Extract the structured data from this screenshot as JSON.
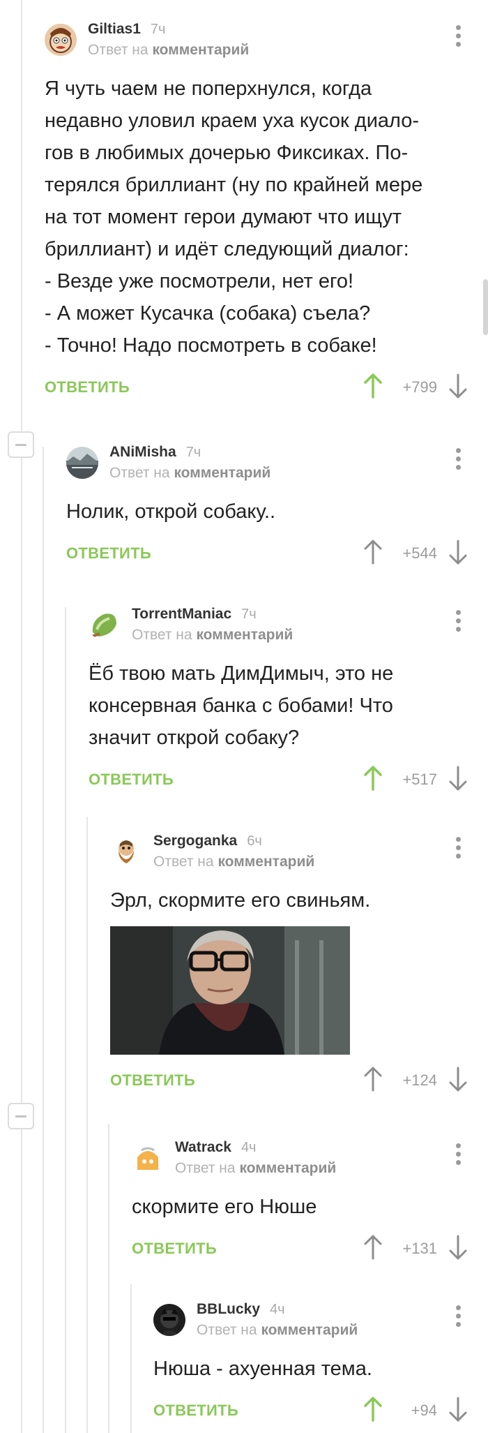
{
  "reply_label": "ОТВЕТИТЬ",
  "reply_prefix": "Ответ на",
  "reply_target": "комментарий",
  "colors": {
    "accent_green": "#8ac858",
    "vote_gray": "#9c9c9c",
    "thread_line": "#e6e6e6"
  },
  "icons": {
    "upvote": "arrow-up-icon",
    "downvote": "arrow-down-icon",
    "more": "more-vertical-icon",
    "collapse": "collapse-thread-icon"
  },
  "comments": [
    {
      "author": "Giltias1",
      "time": "7ч",
      "lines": [
        "Я чуть чаем не поперхнулся, когда",
        "недавно уловил краем уха кусок диало-",
        "гов в любимых дочерью Фиксиках. По-",
        "терялся бриллиант (ну по крайней мере",
        "на тот момент герои думают что ищут",
        "бриллиант) и идёт следующий диалог:",
        "- Везде уже посмотрели, нет его!",
        "- А может Кусачка (собака) съела?",
        "- Точно! Надо посмотреть в собаке!"
      ],
      "rating": "+799",
      "upvoted": true
    },
    {
      "author": "ANiMisha",
      "time": "7ч",
      "lines": [
        "Нолик, открой собаку.."
      ],
      "rating": "+544",
      "upvoted": false
    },
    {
      "author": "TorrentManiac",
      "time": "7ч",
      "lines": [
        "Ёб твою мать ДимДимыч, это не",
        "консервная банка с бобами! Что",
        "значит открой собаку?"
      ],
      "rating": "+517",
      "upvoted": true
    },
    {
      "author": "Sergoganka",
      "time": "6ч",
      "lines": [
        "Эрл, скормите его свиньям."
      ],
      "rating": "+124",
      "upvoted": false,
      "has_gif": true
    },
    {
      "author": "Watrack",
      "time": "4ч",
      "lines": [
        "скормите его Нюше"
      ],
      "rating": "+131",
      "upvoted": false
    },
    {
      "author": "BBLucky",
      "time": "4ч",
      "lines": [
        "Нюша - ахуенная тема."
      ],
      "rating": "+94",
      "upvoted": true
    }
  ]
}
